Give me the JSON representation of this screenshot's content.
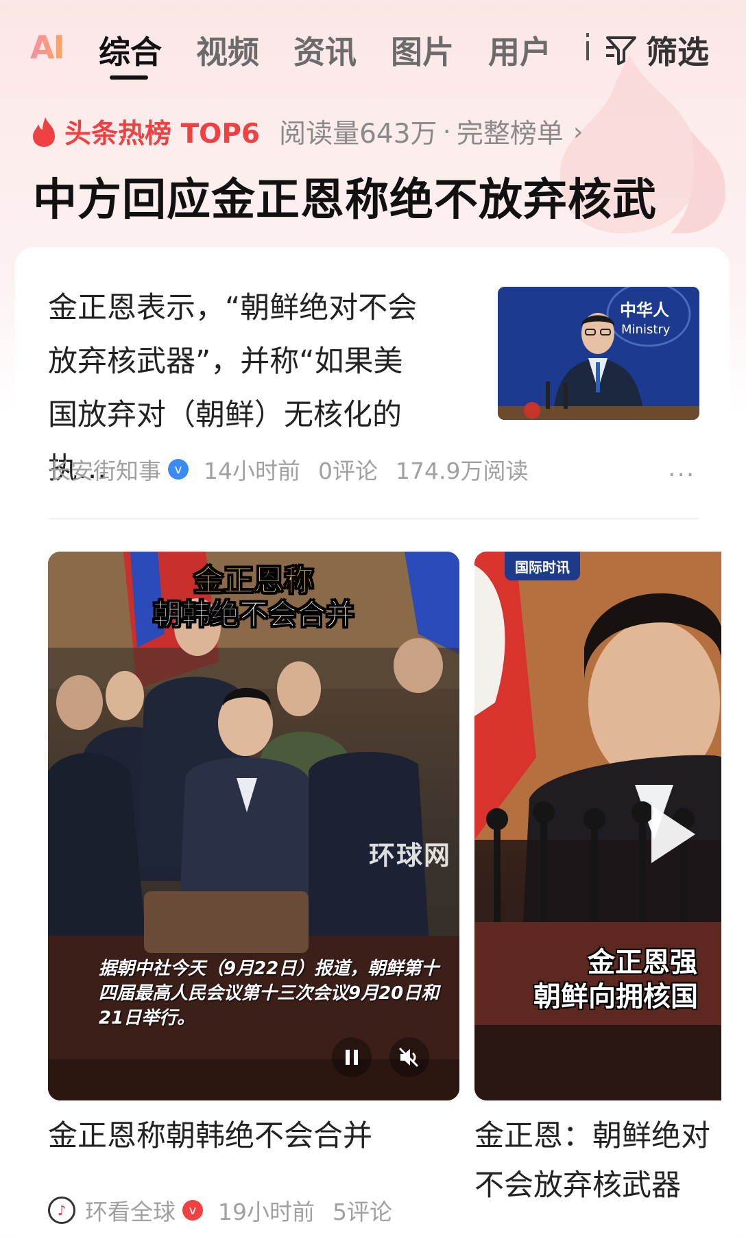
{
  "tabs": {
    "ai_label": "AI",
    "items": [
      {
        "label": "综合",
        "active": true
      },
      {
        "label": "视频",
        "active": false
      },
      {
        "label": "资讯",
        "active": false
      },
      {
        "label": "图片",
        "active": false
      },
      {
        "label": "用户",
        "active": false
      }
    ],
    "filter_label": "筛选"
  },
  "hotlist": {
    "label": "头条热榜 TOP6",
    "reads": "阅读量643万",
    "separator": "·",
    "full_list": "完整榜单",
    "chevron": "›"
  },
  "headline": "中方回应金正恩称绝不放弃核武",
  "article": {
    "text": "金正恩表示，“朝鲜绝对不会放弃核武器”，并称“如果美国放弃对（朝鲜）无核化的执…",
    "author": "长安街知事",
    "verified_mark": "v",
    "time": "14小时前",
    "comments": "0评论",
    "reads": "174.9万阅读",
    "more": "···",
    "thumb_sign": "中华人",
    "thumb_sign_en": "Ministry"
  },
  "videos": [
    {
      "overlay_line1": "金正恩称",
      "overlay_line2": "朝韩绝不会合并",
      "watermark": "环球网",
      "caption": "据朝中社今天（9月22日）报道，朝鲜第十四届最高人民会议第十三次会议9月20日和21日举行。",
      "title": "金正恩称朝韩绝不会合并",
      "author": "环看全球",
      "author_badge": "v",
      "time": "19小时前",
      "comments": "5评论"
    },
    {
      "badge": "国际时讯",
      "caption_line1": "金正恩强",
      "caption_line2": "朝鲜向拥核国",
      "title": "金正恩：朝鲜绝对不会放弃核武器"
    }
  ],
  "colors": {
    "accent_red": "#f04142",
    "verified_blue": "#3b8bf5",
    "muted": "#a0a0a0"
  }
}
